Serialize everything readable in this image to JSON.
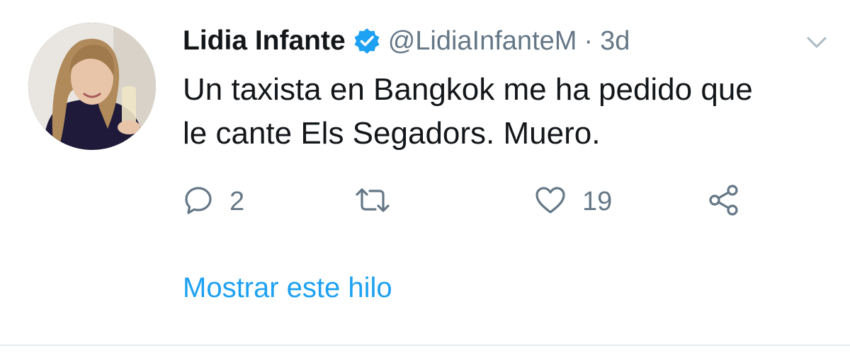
{
  "tweet": {
    "author_name": "Lidia Infante",
    "author_handle": "@LidiaInfanteM",
    "separator": "·",
    "time_ago": "3d",
    "text_line1": "Un taxista en Bangkok me ha pedido que",
    "text_line2": "le cante Els Segadors. Muero.",
    "reply_count": "2",
    "retweet_count": "",
    "like_count": "19",
    "show_thread_label": "Mostrar este hilo"
  },
  "icons": {
    "verified": "verified-badge-icon",
    "caret": "chevron-down-icon",
    "reply": "reply-icon",
    "retweet": "retweet-icon",
    "like": "heart-icon",
    "share": "share-icon"
  },
  "colors": {
    "text": "#14171a",
    "muted": "#657786",
    "link": "#1da1f2",
    "verified": "#1da1f2",
    "divider": "#e6ecf0"
  }
}
